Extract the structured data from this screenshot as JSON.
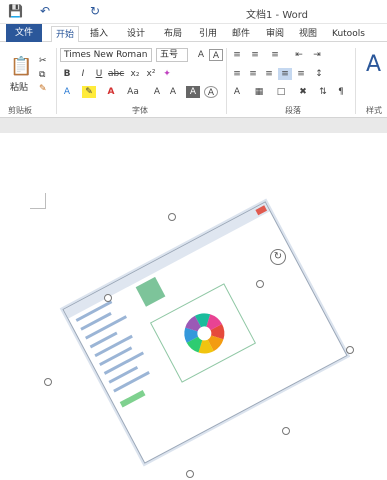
{
  "window": {
    "title": "文档1 - Word"
  },
  "tabs": {
    "file": "文件",
    "home": "开始",
    "insert": "插入",
    "design": "设计",
    "layout": "布局",
    "references": "引用",
    "mailings": "邮件",
    "review": "审阅",
    "view": "视图",
    "kutools": "Kutools"
  },
  "ribbon": {
    "paste_label": "粘贴",
    "font_name": "Times New Roman",
    "font_size": "五号",
    "clipboard_group": "剪贴板",
    "font_group": "字体",
    "paragraph_group": "段落",
    "styles_group": "样式"
  },
  "colors": {
    "brand": "#2b579a",
    "pie": [
      "#e64a3c",
      "#f39c12",
      "#f1c40f",
      "#2ecc71",
      "#3498db",
      "#9b59b6",
      "#1abc9c",
      "#e84393"
    ]
  }
}
